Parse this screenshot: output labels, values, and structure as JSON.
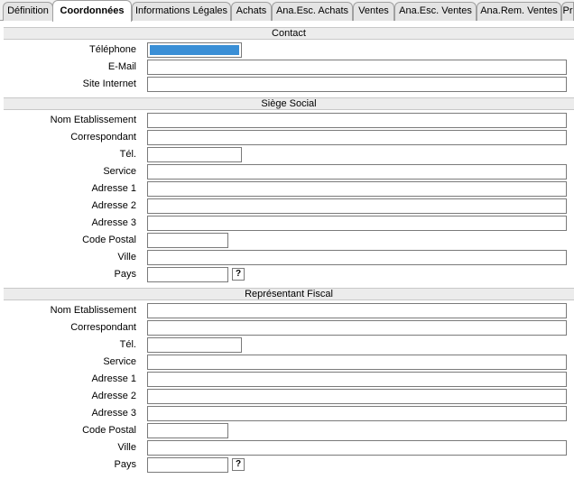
{
  "tabs": [
    {
      "label": "Définition"
    },
    {
      "label": "Coordonnées",
      "active": true
    },
    {
      "label": "Informations Légales"
    },
    {
      "label": "Achats"
    },
    {
      "label": "Ana.Esc. Achats"
    },
    {
      "label": "Ventes"
    },
    {
      "label": "Ana.Esc. Ventes"
    },
    {
      "label": "Ana.Rem. Ventes"
    },
    {
      "label": "Pr"
    }
  ],
  "contact": {
    "title": "Contact",
    "telephone_label": "Téléphone",
    "telephone_value": "",
    "email_label": "E-Mail",
    "email_value": "",
    "site_label": "Site Internet",
    "site_value": ""
  },
  "siege": {
    "title": "Siège Social",
    "nom_label": "Nom Etablissement",
    "correspondant_label": "Correspondant",
    "tel_label": "Tél.",
    "service_label": "Service",
    "adresse1_label": "Adresse 1",
    "adresse2_label": "Adresse 2",
    "adresse3_label": "Adresse 3",
    "cp_label": "Code Postal",
    "ville_label": "Ville",
    "pays_label": "Pays",
    "lookup_label": "?"
  },
  "representant": {
    "title": "Représentant Fiscal",
    "nom_label": "Nom Etablissement",
    "correspondant_label": "Correspondant",
    "tel_label": "Tél.",
    "service_label": "Service",
    "adresse1_label": "Adresse 1",
    "adresse2_label": "Adresse 2",
    "adresse3_label": "Adresse 3",
    "cp_label": "Code Postal",
    "ville_label": "Ville",
    "pays_label": "Pays",
    "lookup_label": "?"
  }
}
